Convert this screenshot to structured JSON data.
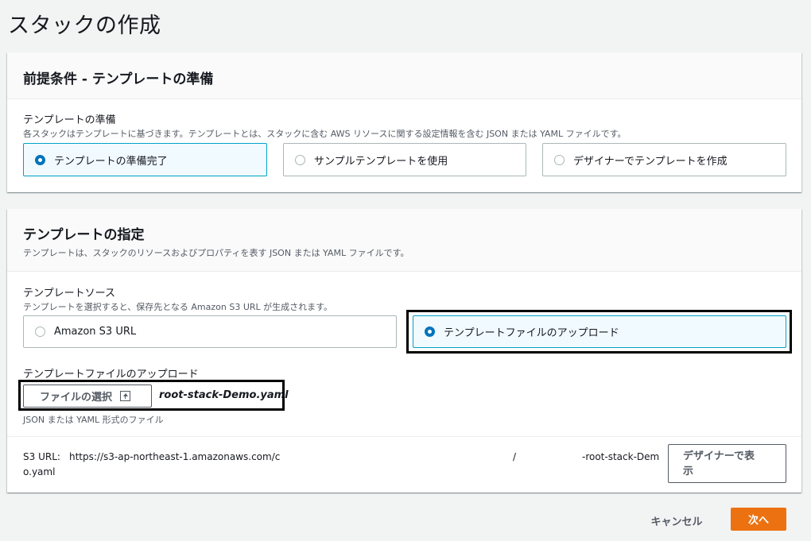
{
  "page": {
    "title": "スタックの作成"
  },
  "prereq": {
    "title": "前提条件 - テンプレートの準備",
    "field_label": "テンプレートの準備",
    "field_desc": "各スタックはテンプレートに基づきます。テンプレートとは、スタックに含む AWS リソースに関する設定情報を含む JSON または YAML ファイルです。",
    "options": [
      {
        "label": "テンプレートの準備完了",
        "selected": true
      },
      {
        "label": "サンプルテンプレートを使用",
        "selected": false
      },
      {
        "label": "デザイナーでテンプレートを作成",
        "selected": false
      }
    ]
  },
  "specify": {
    "title": "テンプレートの指定",
    "desc": "テンプレートは、スタックのリソースおよびプロパティを表す JSON または YAML ファイルです。",
    "source_label": "テンプレートソース",
    "source_desc": "テンプレートを選択すると、保存先となる Amazon S3 URL が生成されます。",
    "sources": [
      {
        "label": "Amazon S3 URL",
        "selected": false
      },
      {
        "label": "テンプレートファイルのアップロード",
        "selected": true
      }
    ],
    "upload_label": "テンプレートファイルのアップロード",
    "choose_file_label": "ファイルの選択",
    "file_name": "root-stack-Demo.yaml",
    "upload_hint": "JSON または YAML 形式のファイル",
    "s3_url_label": "S3 URL:",
    "s3_url_part1": "https://s3-ap-northeast-1.amazonaws.com/c",
    "s3_url_slash": "/",
    "s3_url_part2": "-root-stack-Dem",
    "s3_url_tail": "o.yaml",
    "designer_button": "デザイナーで表示"
  },
  "footer": {
    "cancel": "キャンセル",
    "next": "次へ"
  },
  "colors": {
    "primary": "#ec7211",
    "selected_bg": "#f1faff",
    "radio_on": "#0073bb"
  }
}
